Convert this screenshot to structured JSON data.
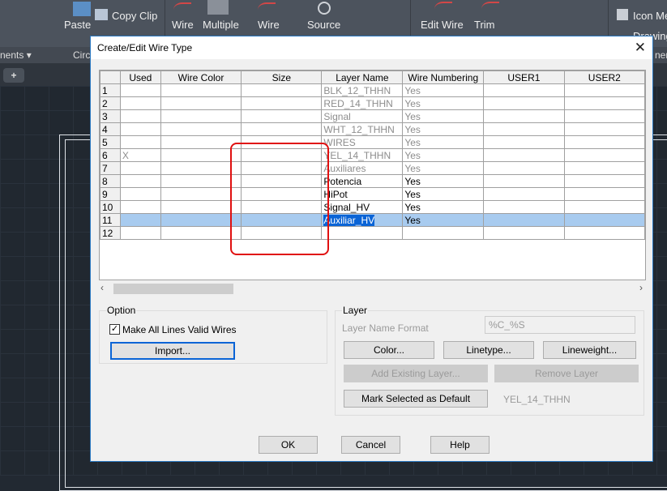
{
  "ribbon": {
    "paste": "Paste",
    "copy_clip": "Copy Clip",
    "wire": "Wire",
    "multiple": "Multiple",
    "wire_numbers": "Wire",
    "source": "Source",
    "edit_wire": "Edit Wire",
    "trim": "Trim",
    "icon_menu": "Icon Me",
    "drawing": "Drawing",
    "panel_components": "nents ▾",
    "panel_circuit": "Circ",
    "panel_other": "ner",
    "new_tab": "+"
  },
  "dialog": {
    "title": "Create/Edit Wire Type",
    "close": "✕",
    "columns": [
      "",
      "Used",
      "Wire Color",
      "Size",
      "Layer Name",
      "Wire Numbering",
      "USER1",
      "USER2"
    ],
    "rows": [
      {
        "n": "1",
        "used": "",
        "layer": "BLK_12_THHN",
        "num": "Yes",
        "state": "gray"
      },
      {
        "n": "2",
        "used": "",
        "layer": "RED_14_THHN",
        "num": "Yes",
        "state": "gray"
      },
      {
        "n": "3",
        "used": "",
        "layer": "Signal",
        "num": "Yes",
        "state": "gray"
      },
      {
        "n": "4",
        "used": "",
        "layer": "WHT_12_THHN",
        "num": "Yes",
        "state": "gray"
      },
      {
        "n": "5",
        "used": "",
        "layer": "WIRES",
        "num": "Yes",
        "state": "gray"
      },
      {
        "n": "6",
        "used": "X",
        "layer": "YEL_14_THHN",
        "num": "Yes",
        "state": "gray"
      },
      {
        "n": "7",
        "used": "",
        "layer": "Auxiliares",
        "num": "Yes",
        "state": "gray"
      },
      {
        "n": "8",
        "used": "",
        "layer": "Potencia",
        "num": "Yes",
        "state": "black"
      },
      {
        "n": "9",
        "used": "",
        "layer": "HiPot",
        "num": "Yes",
        "state": "black"
      },
      {
        "n": "10",
        "used": "",
        "layer": "Signal_HV",
        "num": "Yes",
        "state": "black"
      },
      {
        "n": "11",
        "used": "",
        "layer": "Auxiliar_HV",
        "num": "Yes",
        "state": "selected"
      },
      {
        "n": "12",
        "used": "",
        "layer": "",
        "num": "",
        "state": "empty"
      }
    ],
    "option": {
      "caption": "Option",
      "checkbox_label": "Make All Lines Valid Wires",
      "checked": true,
      "import": "Import..."
    },
    "layer": {
      "caption": "Layer",
      "name_format_label": "Layer Name Format",
      "name_format_value": "%C_%S",
      "color": "Color...",
      "linetype": "Linetype...",
      "lineweight": "Lineweight...",
      "add_existing": "Add Existing Layer...",
      "remove": "Remove Layer",
      "mark_default": "Mark Selected as Default",
      "default_value": "YEL_14_THHN"
    },
    "ok": "OK",
    "cancel": "Cancel",
    "help": "Help"
  },
  "colors": {
    "selection": "#a8cbef",
    "highlight": "#0a64d6",
    "annotation": "#e01010",
    "canvas": "#212830"
  }
}
